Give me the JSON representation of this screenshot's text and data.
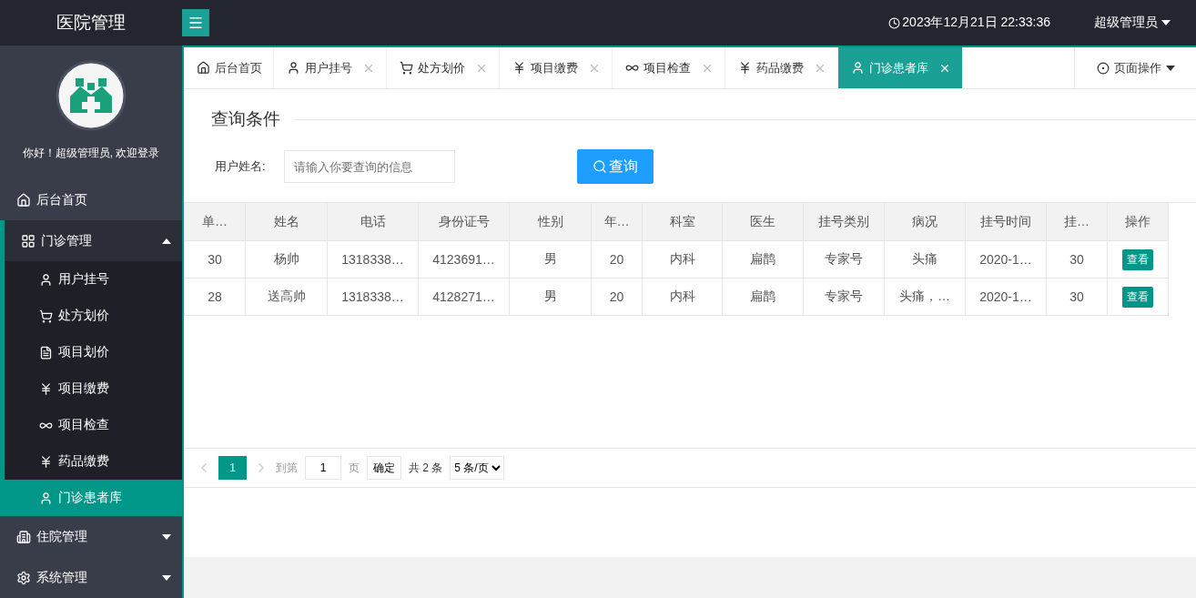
{
  "header": {
    "title": "医院管理",
    "datetime": "2023年12月21日 22:33:36",
    "user": "超级管理员"
  },
  "sidebar": {
    "greeting": "你好！超级管理员, 欢迎登录",
    "items": [
      {
        "kind": "link",
        "label": "后台首页",
        "selected": false
      },
      {
        "kind": "group",
        "label": "门诊管理",
        "expanded": true,
        "children": [
          {
            "label": "用户挂号",
            "selected": false
          },
          {
            "label": "处方划价",
            "selected": false
          },
          {
            "label": "项目划价",
            "selected": false
          },
          {
            "label": "项目缴费",
            "selected": false
          },
          {
            "label": "项目检查",
            "selected": false
          },
          {
            "label": "药品缴费",
            "selected": false
          },
          {
            "label": "门诊患者库",
            "selected": true
          }
        ]
      },
      {
        "kind": "group",
        "label": "住院管理",
        "expanded": false
      },
      {
        "kind": "group",
        "label": "系统管理",
        "expanded": false
      }
    ]
  },
  "tabs": [
    {
      "label": "后台首页",
      "closable": false,
      "selected": false
    },
    {
      "label": "用户挂号",
      "closable": true,
      "selected": false
    },
    {
      "label": "处方划价",
      "closable": true,
      "selected": false
    },
    {
      "label": "项目缴费",
      "closable": true,
      "selected": false
    },
    {
      "label": "项目检查",
      "closable": true,
      "selected": false
    },
    {
      "label": "药品缴费",
      "closable": true,
      "selected": false
    },
    {
      "label": "门诊患者库",
      "closable": true,
      "selected": true
    }
  ],
  "page_actions": "页面操作",
  "query": {
    "legend": "查询条件",
    "field_label": "用户姓名:",
    "placeholder": "请输入你要查询的信息",
    "button": "查询"
  },
  "table": {
    "columns": [
      "单…",
      "姓名",
      "电话",
      "身份证号",
      "性别",
      "年…",
      "科室",
      "医生",
      "挂号类别",
      "病况",
      "挂号时间",
      "挂…",
      "操作"
    ],
    "rows": [
      {
        "cells": [
          "30",
          "杨帅",
          "1318338…",
          "4123691…",
          "男",
          "20",
          "内科",
          "扁鹊",
          "专家号",
          "头痛",
          "2020-1…",
          "30"
        ],
        "action": "查看"
      },
      {
        "cells": [
          "28",
          "送高帅",
          "1318338…",
          "4128271…",
          "男",
          "20",
          "内科",
          "扁鹊",
          "专家号",
          "头痛，…",
          "2020-1…",
          "30"
        ],
        "action": "查看"
      }
    ]
  },
  "pager": {
    "pages": [
      {
        "label": "1",
        "selected": true
      }
    ],
    "goto": "到第",
    "page_value": "1",
    "page_unit": "页",
    "confirm": "确定",
    "total": "共 2 条",
    "page_size": "5 条/页"
  }
}
